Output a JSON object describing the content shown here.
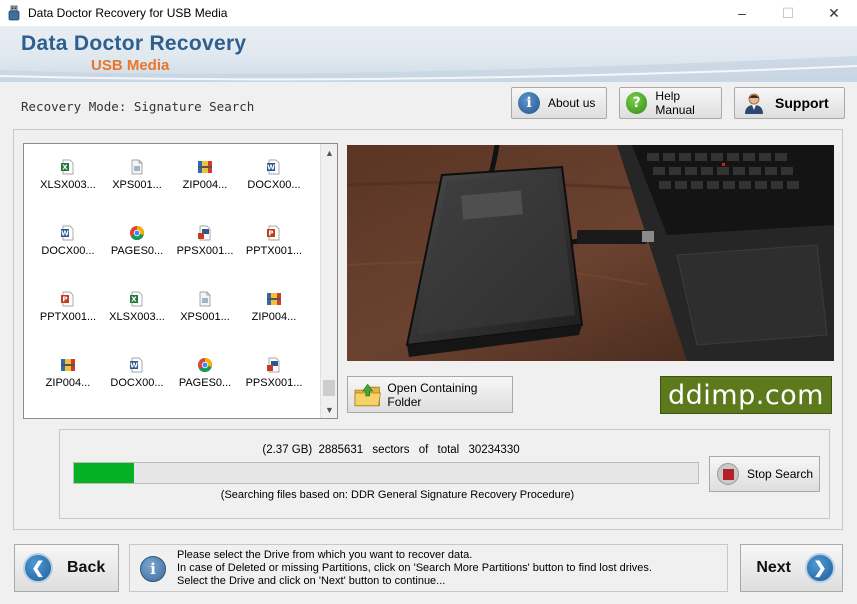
{
  "window": {
    "title": "Data Doctor Recovery for USB Media",
    "minimize_icon": "minimize-icon",
    "maximize_icon": "maximize-icon",
    "close_icon": "close-icon"
  },
  "header": {
    "brand": "Data Doctor Recovery",
    "subtitle": "USB Media"
  },
  "toolbar": {
    "mode_label": "Recovery Mode: Signature Search",
    "about_label": "About us",
    "help_label": "Help Manual",
    "support_label": "Support"
  },
  "files": [
    {
      "name": "XLSX003...",
      "icon": "excel-file-icon"
    },
    {
      "name": "XPS001...",
      "icon": "xps-file-icon"
    },
    {
      "name": "ZIP004...",
      "icon": "zip-archive-icon"
    },
    {
      "name": "DOCX00...",
      "icon": "word-file-icon"
    },
    {
      "name": "DOCX00...",
      "icon": "word-file-icon"
    },
    {
      "name": "PAGES0...",
      "icon": "pages-chrome-icon"
    },
    {
      "name": "PPSX001...",
      "icon": "ppsx-file-icon"
    },
    {
      "name": "PPTX001...",
      "icon": "powerpoint-file-icon"
    },
    {
      "name": "PPTX001...",
      "icon": "powerpoint-file-icon"
    },
    {
      "name": "XLSX003...",
      "icon": "excel-file-icon"
    },
    {
      "name": "XPS001...",
      "icon": "xps-file-icon"
    },
    {
      "name": "ZIP004...",
      "icon": "zip-archive-icon"
    },
    {
      "name": "ZIP004...",
      "icon": "zip-archive-icon"
    },
    {
      "name": "DOCX00...",
      "icon": "word-file-icon"
    },
    {
      "name": "PAGES0...",
      "icon": "pages-chrome-icon"
    },
    {
      "name": "PPSX001...",
      "icon": "ppsx-file-icon"
    }
  ],
  "actions": {
    "open_folder_label": "Open Containing Folder",
    "logo_text": "ddimp.com"
  },
  "progress": {
    "size": "(2.37 GB)",
    "sectors": "2885631",
    "word_sectors": "sectors",
    "word_of": "of",
    "word_total": "total",
    "total": "30234330",
    "percent": 9.54,
    "note": "(Searching files based on:  DDR General Signature Recovery Procedure)",
    "stop_label": "Stop Search"
  },
  "footer": {
    "back_label": "Back",
    "next_label": "Next",
    "info_lines": [
      "Please select the Drive from which you want to recover data.",
      "In case of Deleted or missing Partitions, click on 'Search More Partitions' button to find lost drives.",
      "Select the Drive and click on 'Next' button to continue..."
    ]
  },
  "colors": {
    "progress_fill": "#06b025",
    "brand_blue": "#2e5f8f",
    "brand_orange": "#e8772a",
    "logo_green": "#5c7a1c"
  }
}
